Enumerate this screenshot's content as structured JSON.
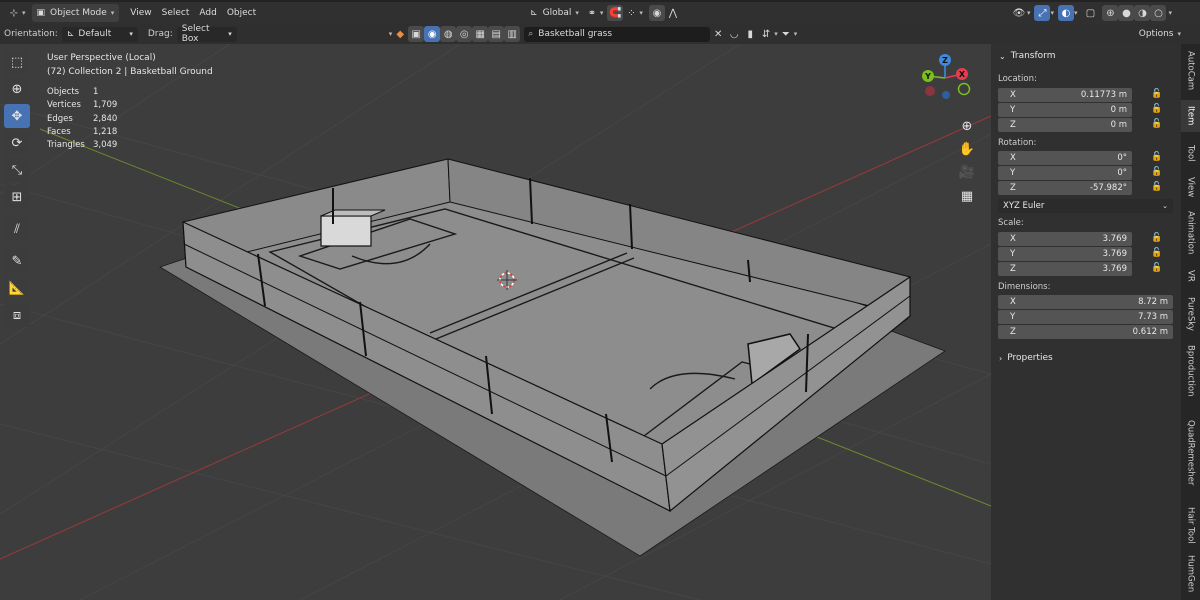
{
  "header": {
    "mode_label": "Object Mode",
    "menus": [
      "View",
      "Select",
      "Add",
      "Object"
    ],
    "orientation_global": "Global",
    "options_label": "Options"
  },
  "tool_settings": {
    "orientation_label": "Orientation:",
    "orientation_value": "Default",
    "drag_label": "Drag:",
    "drag_value": "Select Box",
    "search_value": "Basketball grass"
  },
  "viewport": {
    "perspective": "User Perspective (Local)",
    "collection": "(72) Collection 2 | Basketball Ground",
    "stats": [
      {
        "label": "Objects",
        "value": "1"
      },
      {
        "label": "Vertices",
        "value": "1,709"
      },
      {
        "label": "Edges",
        "value": "2,840"
      },
      {
        "label": "Faces",
        "value": "1,218"
      },
      {
        "label": "Triangles",
        "value": "3,049"
      }
    ],
    "gizmo": {
      "x": "X",
      "y": "Y",
      "z": "Z"
    }
  },
  "transform": {
    "title": "Transform",
    "location_label": "Location:",
    "location": [
      {
        "axis": "X",
        "value": "0.11773 m"
      },
      {
        "axis": "Y",
        "value": "0 m"
      },
      {
        "axis": "Z",
        "value": "0 m"
      }
    ],
    "rotation_label": "Rotation:",
    "rotation": [
      {
        "axis": "X",
        "value": "0°"
      },
      {
        "axis": "Y",
        "value": "0°"
      },
      {
        "axis": "Z",
        "value": "-57.982°"
      }
    ],
    "rotation_mode": "XYZ Euler",
    "scale_label": "Scale:",
    "scale": [
      {
        "axis": "X",
        "value": "3.769"
      },
      {
        "axis": "Y",
        "value": "3.769"
      },
      {
        "axis": "Z",
        "value": "3.769"
      }
    ],
    "dimensions_label": "Dimensions:",
    "dimensions": [
      {
        "axis": "X",
        "value": "8.72 m"
      },
      {
        "axis": "Y",
        "value": "7.73 m"
      },
      {
        "axis": "Z",
        "value": "0.612 m"
      }
    ],
    "properties_title": "Properties"
  },
  "sidebar_tabs": [
    "AutoCam",
    "Item",
    "Tool",
    "View",
    "Animation",
    "VR",
    "PureSky",
    "Bproduction",
    "QuadRemesher",
    "Hair Tool",
    "HumGen"
  ],
  "colors": {
    "accent": "#4772b3",
    "axis_x": "#e63c4d",
    "axis_y": "#7bbf1e",
    "axis_z": "#3d8be0"
  }
}
